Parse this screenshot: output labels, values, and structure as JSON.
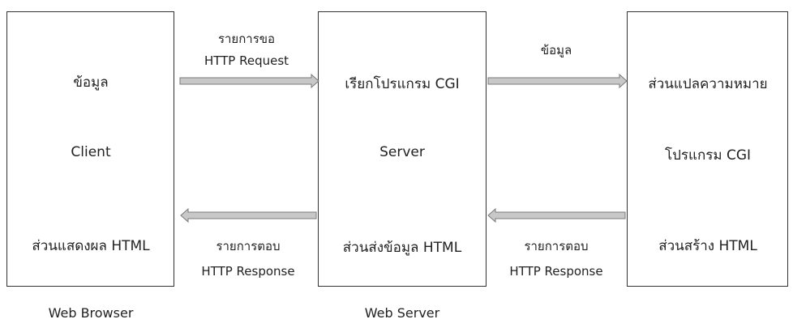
{
  "colors": {
    "arrow_fill": "#c8c8c8",
    "arrow_stroke": "#7a7a7a",
    "box_border": "#333333"
  },
  "client": {
    "top_label": "ข้อมูล",
    "middle_label": "Client",
    "bottom_label": "ส่วนแสดงผล HTML",
    "caption": "Web Browser"
  },
  "server": {
    "top_label": "เรียกโปรแกรม CGI",
    "middle_label": "Server",
    "bottom_label": "ส่วนส่งข้อมูล HTML",
    "caption": "Web Server"
  },
  "cgi": {
    "top_label": "ส่วนแปลความหมาย",
    "middle_label": "โปรแกรม CGI",
    "bottom_label": "ส่วนสร้าง HTML"
  },
  "arrows": {
    "request": {
      "line1": "รายการขอ",
      "line2": "HTTP Request"
    },
    "data": {
      "label": "ข้อมูล"
    },
    "response_left": {
      "line1": "รายการตอบ",
      "line2": "HTTP Response"
    },
    "response_right": {
      "line1": "รายการตอบ",
      "line2": "HTTP Response"
    }
  }
}
